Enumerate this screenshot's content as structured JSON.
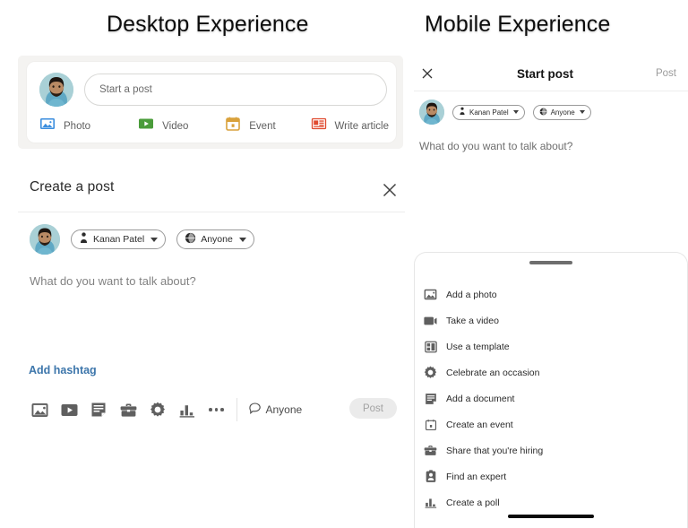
{
  "headings": {
    "desktop": "Desktop Experience",
    "mobile": "Mobile Experience"
  },
  "colors": {
    "photo_icon": "#3a8dde",
    "video_icon": "#4a9c3a",
    "event_icon": "#d9a13b",
    "article_icon": "#e04a2f",
    "link_blue": "#3d76ab",
    "panel_gray": "#f4f3f1",
    "disabled_post_bg": "#ebebeb",
    "disabled_post_text": "#a3a3a3"
  },
  "desktop": {
    "start_post": {
      "input_placeholder": "Start a post",
      "avatar_alt": "Kanan Patel",
      "actions": [
        {
          "label": "Photo",
          "icon": "image-icon"
        },
        {
          "label": "Video",
          "icon": "video-play-icon"
        },
        {
          "label": "Event",
          "icon": "calendar-icon"
        },
        {
          "label": "Write article",
          "icon": "article-icon"
        }
      ]
    },
    "create_post": {
      "title": "Create a post",
      "close_icon": "close-icon",
      "author_chip": {
        "label": "Kanan Patel",
        "icon": "person-icon"
      },
      "audience_chip": {
        "label": "Anyone",
        "icon": "globe-icon"
      },
      "editor_placeholder": "What do you want to talk about?",
      "hashtag_link": "Add hashtag",
      "toolbar_icons": [
        "image-icon",
        "video-icon",
        "document-icon",
        "briefcase-icon",
        "celebrate-icon",
        "poll-icon",
        "more-icon"
      ],
      "audience_label": "Anyone",
      "audience_icon": "comment-icon",
      "post_button": "Post"
    }
  },
  "mobile": {
    "topbar": {
      "close_icon": "close-icon",
      "title": "Start post",
      "post_label": "Post"
    },
    "author_chip": {
      "label": "Kanan Patel",
      "icon": "person-icon"
    },
    "audience_chip": {
      "label": "Anyone",
      "icon": "globe-icon"
    },
    "editor_placeholder": "What do you want to talk about?",
    "sheet": {
      "handle": "drag-handle",
      "items": [
        {
          "label": "Add a photo",
          "icon": "image-icon"
        },
        {
          "label": "Take a video",
          "icon": "video-icon"
        },
        {
          "label": "Use a template",
          "icon": "template-icon"
        },
        {
          "label": "Celebrate an occasion",
          "icon": "celebrate-icon"
        },
        {
          "label": "Add a document",
          "icon": "document-icon"
        },
        {
          "label": "Create an event",
          "icon": "calendar-icon"
        },
        {
          "label": "Share that you're hiring",
          "icon": "briefcase-icon"
        },
        {
          "label": "Find an expert",
          "icon": "expert-icon"
        },
        {
          "label": "Create a poll",
          "icon": "poll-icon"
        }
      ]
    }
  }
}
